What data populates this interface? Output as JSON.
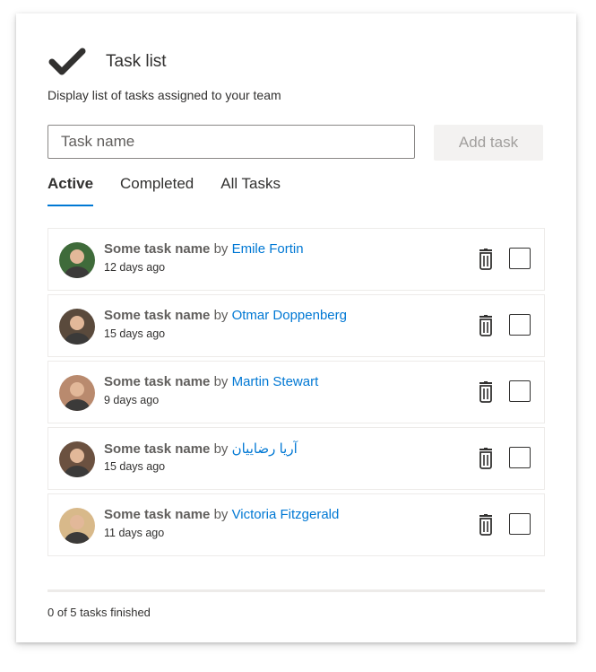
{
  "header": {
    "title": "Task list",
    "subtitle": "Display list of tasks assigned to your team",
    "icon": "checkmark-icon"
  },
  "new_task": {
    "placeholder": "Task name",
    "add_label": "Add task"
  },
  "tabs": [
    {
      "label": "Active",
      "selected": true
    },
    {
      "label": "Completed",
      "selected": false
    },
    {
      "label": "All Tasks",
      "selected": false
    }
  ],
  "tasks": [
    {
      "name": "Some task name",
      "by": "by",
      "user": "Emile Fortin",
      "time": "12 days ago",
      "avatar_color": "#3f6b3a",
      "done": false
    },
    {
      "name": "Some task name",
      "by": "by",
      "user": "Otmar Doppenberg",
      "time": "15 days ago",
      "avatar_color": "#5a4a3c",
      "done": false
    },
    {
      "name": "Some task name",
      "by": "by",
      "user": "Martin Stewart",
      "time": "9 days ago",
      "avatar_color": "#b98a6e",
      "done": false
    },
    {
      "name": "Some task name",
      "by": "by",
      "user": "آریا رضاییان",
      "time": "15 days ago",
      "avatar_color": "#6b5140",
      "done": false
    },
    {
      "name": "Some task name",
      "by": "by",
      "user": "Victoria Fitzgerald",
      "time": "11 days ago",
      "avatar_color": "#d8b98a",
      "done": false
    }
  ],
  "footer": {
    "status": "0 of 5 tasks finished"
  },
  "colors": {
    "accent": "#0078d4",
    "text": "#323130",
    "muted": "#605e5c"
  }
}
